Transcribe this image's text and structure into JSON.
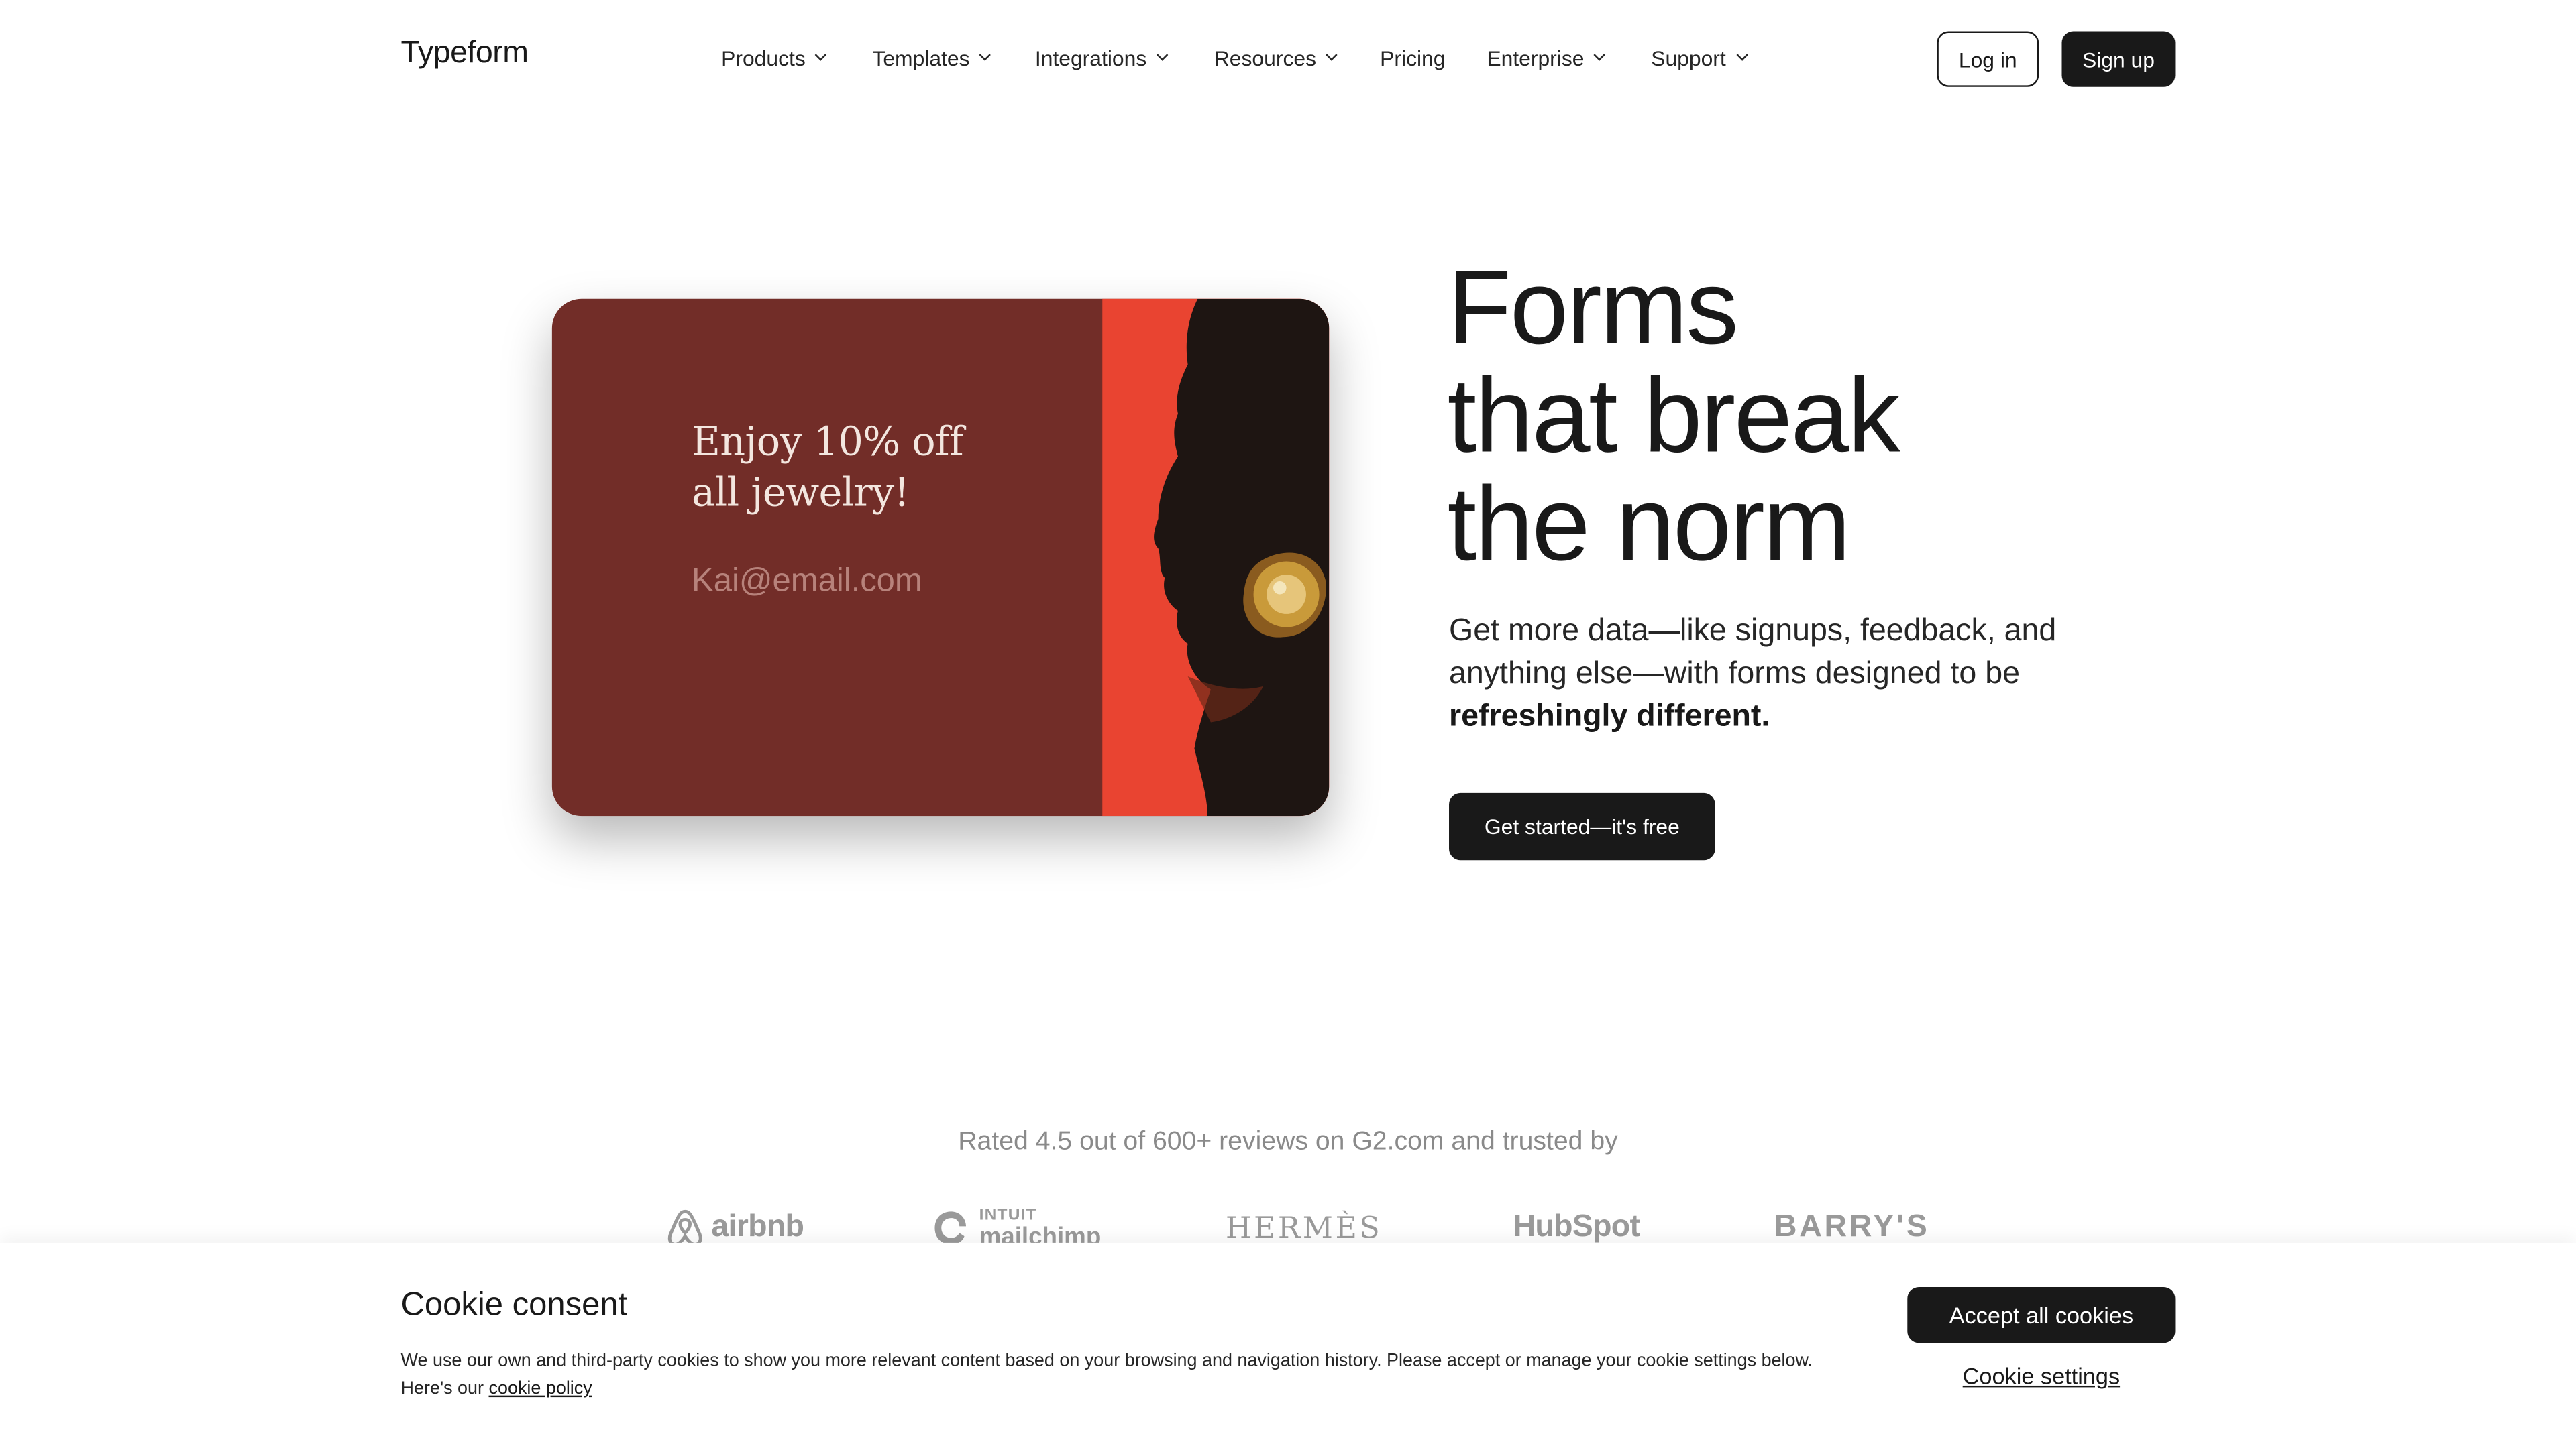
{
  "header": {
    "logo": "Typeform",
    "nav": [
      {
        "label": "Products",
        "dropdown": true
      },
      {
        "label": "Templates",
        "dropdown": true
      },
      {
        "label": "Integrations",
        "dropdown": true
      },
      {
        "label": "Resources",
        "dropdown": true
      },
      {
        "label": "Pricing",
        "dropdown": false
      },
      {
        "label": "Enterprise",
        "dropdown": true
      },
      {
        "label": "Support",
        "dropdown": true
      }
    ],
    "login_label": "Log in",
    "signup_label": "Sign up"
  },
  "hero": {
    "card": {
      "headline": "Enjoy 10% off\nall jewelry!",
      "email_placeholder": "Kai@email.com",
      "colors": {
        "panel": "#722d28",
        "photo_bg": "#e94431"
      }
    },
    "title_lines": [
      "Forms",
      "that break",
      "the norm"
    ],
    "subtitle_text": "Get more data—like signups, feedback, and anything else—with forms designed to be",
    "subtitle_bold": "refreshingly different.",
    "cta_label": "Get started—it's free"
  },
  "trusted": {
    "rated_text": "Rated 4.5 out of 600+ reviews on G2.com and trusted by",
    "logos": [
      {
        "name": "airbnb",
        "icon": "airbnb-logo-icon"
      },
      {
        "name": "mailchimp",
        "kicker": "INTUIT",
        "icon": "mailchimp-logo-icon"
      },
      {
        "name": "HERMÈS",
        "icon": "hermes-logo"
      },
      {
        "name": "HubSpot",
        "icon": "hubspot-logo"
      },
      {
        "name": "BARRY'S",
        "icon": "barrys-logo"
      }
    ]
  },
  "cookie": {
    "title": "Cookie consent",
    "text": "We use our own and third-party cookies to show you more relevant content based on your browsing and navigation history. Please accept or manage your cookie settings below. Here's our",
    "link_label": "cookie policy",
    "accept_label": "Accept all cookies",
    "settings_label": "Cookie settings"
  },
  "colors": {
    "text": "#191919",
    "muted": "#8a8a8a",
    "button_dark": "#191919",
    "background": "#ffffff"
  }
}
